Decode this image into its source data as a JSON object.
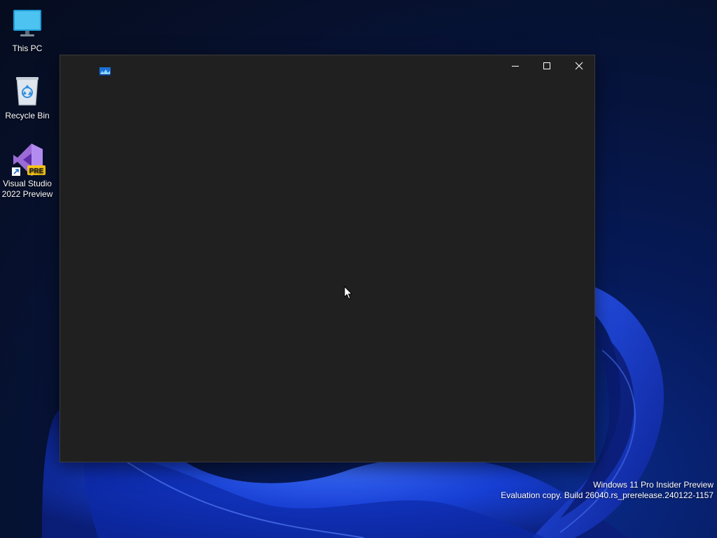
{
  "desktop": {
    "icons": [
      {
        "label": "This PC",
        "icon": "monitor-icon"
      },
      {
        "label": "Recycle Bin",
        "icon": "recycle-bin-icon"
      },
      {
        "label_line1": "Visual Studio",
        "label_line2": "2022 Preview",
        "icon": "visual-studio-preview-icon",
        "badge": "PRE"
      }
    ],
    "watermark": {
      "line1": "Windows 11 Pro Insider Preview",
      "line2": "Evaluation copy. Build 26040.rs_prerelease.240122-1157"
    }
  },
  "window": {
    "app_icon": "app-image-icon",
    "controls": [
      "minimize-icon",
      "maximize-icon",
      "close-icon"
    ]
  },
  "colors": {
    "window_bg": "#202020",
    "desktop_bg": "#06143e",
    "bloom": "#1f4fff"
  }
}
